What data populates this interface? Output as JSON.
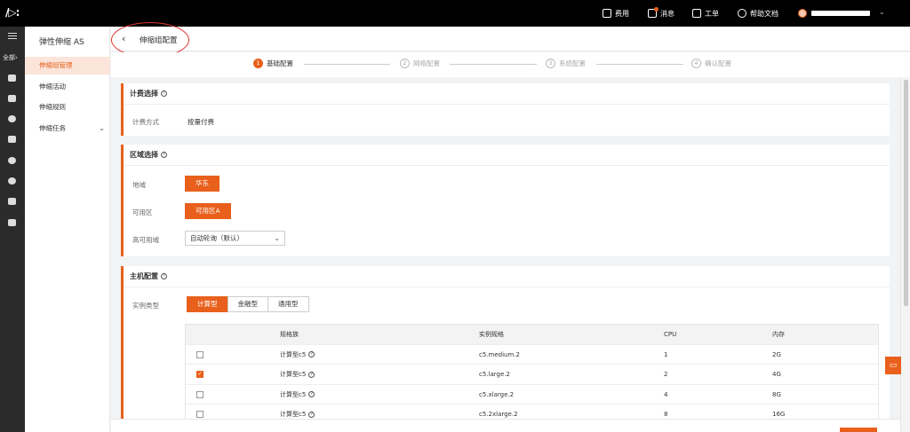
{
  "header": {
    "items": [
      {
        "label": "费用",
        "icon": "billing-icon"
      },
      {
        "label": "消息",
        "icon": "message-icon"
      },
      {
        "label": "工单",
        "icon": "ticket-icon"
      },
      {
        "label": "帮助文档",
        "icon": "help-icon"
      }
    ]
  },
  "rail": {
    "all_label": "全部",
    "icons": [
      "cube-icon",
      "database-icon",
      "globe-icon",
      "storage-icon",
      "cloud-upload-icon",
      "cloud-icon",
      "close-box-icon",
      "stack-icon"
    ]
  },
  "subnav": {
    "title": "弹性伸缩 AS",
    "items": [
      {
        "label": "伸缩组管理",
        "active": true
      },
      {
        "label": "伸缩活动",
        "active": false
      },
      {
        "label": "伸缩规则",
        "active": false
      },
      {
        "label": "伸缩任务",
        "active": false
      }
    ]
  },
  "page": {
    "title": "伸缩组配置"
  },
  "steps": [
    {
      "num": "1",
      "label": "基础配置",
      "active": true
    },
    {
      "num": "2",
      "label": "网络配置",
      "active": false
    },
    {
      "num": "3",
      "label": "系统配置",
      "active": false
    },
    {
      "num": "4",
      "label": "确认配置",
      "active": false
    }
  ],
  "billing": {
    "title": "计费选择",
    "method_label": "计费方式",
    "method_value": "按量付费"
  },
  "region": {
    "title": "区域选择",
    "region_label": "地域",
    "region_value": "华东",
    "zone_label": "可用区",
    "zone_value": "可用区A",
    "ha_label": "高可用域",
    "ha_value": "自动轮询（默认）"
  },
  "host": {
    "title": "主机配置",
    "type_label": "实例类型",
    "types": [
      {
        "label": "计算型",
        "active": true
      },
      {
        "label": "金融型",
        "active": false
      },
      {
        "label": "通用型",
        "active": false
      }
    ],
    "columns": {
      "family": "规格族",
      "spec": "实例规格",
      "cpu": "CPU",
      "mem": "内存"
    },
    "rows": [
      {
        "family": "计算型c5",
        "spec": "c5.medium.2",
        "cpu": "1",
        "mem": "2G",
        "checked": false
      },
      {
        "family": "计算型c5",
        "spec": "c5.large.2",
        "cpu": "2",
        "mem": "4G",
        "checked": true
      },
      {
        "family": "计算型c5",
        "spec": "c5.xlarge.2",
        "cpu": "4",
        "mem": "8G",
        "checked": false
      },
      {
        "family": "计算型c5",
        "spec": "c5.2xlarge.2",
        "cpu": "8",
        "mem": "16G",
        "checked": false
      }
    ]
  },
  "colors": {
    "accent": "#e8601c",
    "topbar": "#000000",
    "rail": "#2b2b2b"
  }
}
